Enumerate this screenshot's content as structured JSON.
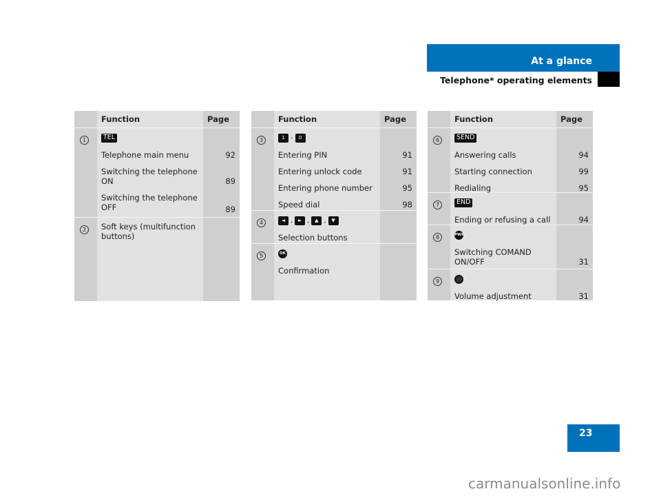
{
  "header": {
    "section": "At a glance",
    "subtitle": "Telephone* operating elements"
  },
  "columns": {
    "function": "Function",
    "page": "Page"
  },
  "tables": [
    {
      "rows": [
        {
          "num": "1",
          "keys": [
            {
              "label": "TEL",
              "icon": "tel-key-icon"
            }
          ],
          "entries": [
            {
              "fn": "Telephone main menu",
              "page": "92"
            },
            {
              "fn": "Switching the telephone ON",
              "page": "89"
            },
            {
              "fn": "Switching the telephone OFF",
              "page": "89"
            }
          ]
        },
        {
          "num": "2",
          "keys": [],
          "entries": [
            {
              "fn": "Soft keys (multifunction buttons)",
              "page": ""
            }
          ]
        }
      ]
    },
    {
      "rows": [
        {
          "num": "3",
          "keys": [
            {
              "label": "1",
              "icon": "key-1-icon"
            },
            {
              "label": "0",
              "icon": "key-0-icon"
            }
          ],
          "key_separator": "-",
          "entries": [
            {
              "fn": "Entering PIN",
              "page": "91"
            },
            {
              "fn": "Entering unlock code",
              "page": "91"
            },
            {
              "fn": "Entering phone number",
              "page": "95"
            },
            {
              "fn": "Speed dial",
              "page": "98"
            }
          ]
        },
        {
          "num": "4",
          "keys": [
            {
              "label": "◄",
              "icon": "arrow-left-key-icon"
            },
            {
              "label": "►",
              "icon": "arrow-right-key-icon"
            },
            {
              "label": "▲",
              "icon": "arrow-up-key-icon"
            },
            {
              "label": "▼",
              "icon": "arrow-down-key-icon"
            }
          ],
          "key_separator": ",",
          "entries": [
            {
              "fn": "Selection buttons",
              "page": ""
            }
          ]
        },
        {
          "num": "5",
          "keys": [
            {
              "label": "OK",
              "icon": "ok-button-icon"
            }
          ],
          "entries": [
            {
              "fn": "Confirmation",
              "page": ""
            }
          ]
        }
      ]
    },
    {
      "rows": [
        {
          "num": "6",
          "keys": [
            {
              "label": "SEND",
              "icon": "send-key-icon"
            }
          ],
          "entries": [
            {
              "fn": "Answering calls",
              "page": "94"
            },
            {
              "fn": "Starting connection",
              "page": "99"
            },
            {
              "fn": "Redialing",
              "page": "95"
            }
          ]
        },
        {
          "num": "7",
          "keys": [
            {
              "label": "END",
              "icon": "end-key-icon"
            }
          ],
          "entries": [
            {
              "fn": "Ending or refusing a call",
              "page": "94"
            }
          ]
        },
        {
          "num": "8",
          "keys": [
            {
              "label": "PWR",
              "icon": "power-button-icon"
            }
          ],
          "entries": [
            {
              "fn": "Switching COMAND ON/OFF",
              "page": "31"
            }
          ]
        },
        {
          "num": "9",
          "keys": [
            {
              "label": "VOL",
              "icon": "volume-knob-icon"
            }
          ],
          "entries": [
            {
              "fn": "Volume adjustment",
              "page": "31"
            }
          ]
        }
      ]
    }
  ],
  "footer": {
    "page_number": "23",
    "watermark": "carmanualsonline.info"
  },
  "colors": {
    "brand_blue": "#0072bc",
    "cell_dark": "#cfcfcf",
    "cell_light": "#e1e1e1"
  }
}
